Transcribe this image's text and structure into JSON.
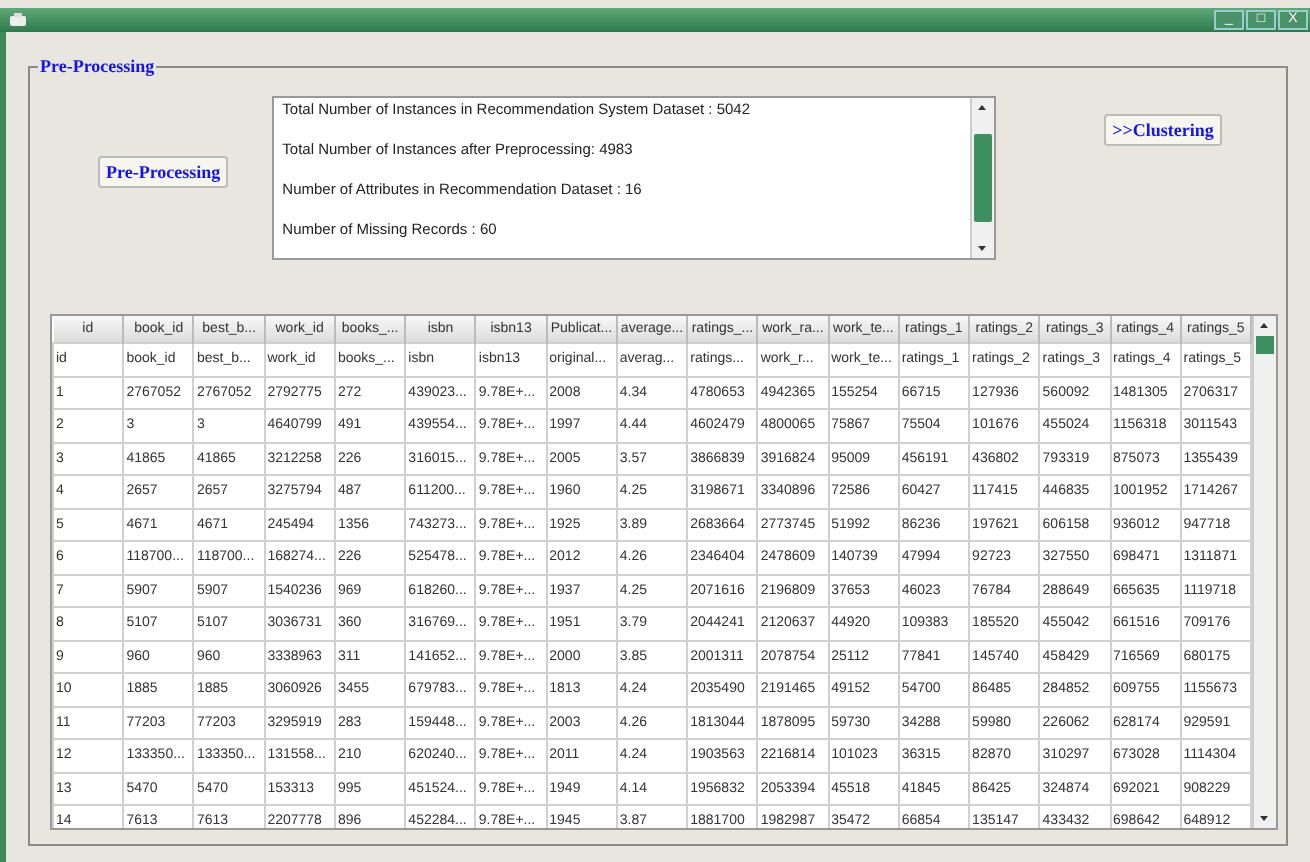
{
  "window": {
    "buttons": [
      "_",
      "□",
      "X"
    ]
  },
  "group": {
    "title": "Pre-Processing"
  },
  "preprocess_button": "Pre-Processing",
  "clustering_button": ">>Clustering",
  "log_lines": [
    "Total Number of Instances in Recommendation System Dataset  : 5042",
    "Total Number of Instances after Preprocessing: 4983",
    "Number of Attributes in Recommendation Dataset : 16",
    "Number of Missing Records : 60"
  ],
  "table": {
    "columns": [
      "id",
      "book_id",
      "best_b...",
      "work_id",
      "books_...",
      "isbn",
      "isbn13",
      "Publicat...",
      "average...",
      "ratings_...",
      "work_ra...",
      "work_te...",
      "ratings_1",
      "ratings_2",
      "ratings_3",
      "ratings_4",
      "ratings_5"
    ],
    "rows": [
      [
        "id",
        "book_id",
        "best_b...",
        "work_id",
        "books_...",
        "isbn",
        "isbn13",
        "original...",
        "averag...",
        "ratings...",
        "work_r...",
        "work_te...",
        "ratings_1",
        "ratings_2",
        "ratings_3",
        "ratings_4",
        "ratings_5"
      ],
      [
        "1",
        "2767052",
        "2767052",
        "2792775",
        "272",
        "439023...",
        "9.78E+...",
        "2008",
        "4.34",
        "4780653",
        "4942365",
        "155254",
        "66715",
        "127936",
        "560092",
        "1481305",
        "2706317"
      ],
      [
        "2",
        "3",
        "3",
        "4640799",
        "491",
        "439554...",
        "9.78E+...",
        "1997",
        "4.44",
        "4602479",
        "4800065",
        "75867",
        "75504",
        "101676",
        "455024",
        "1156318",
        "3011543"
      ],
      [
        "3",
        "41865",
        "41865",
        "3212258",
        "226",
        "316015...",
        "9.78E+...",
        "2005",
        "3.57",
        "3866839",
        "3916824",
        "95009",
        "456191",
        "436802",
        "793319",
        "875073",
        "1355439"
      ],
      [
        "4",
        "2657",
        "2657",
        "3275794",
        "487",
        "611200...",
        "9.78E+...",
        "1960",
        "4.25",
        "3198671",
        "3340896",
        "72586",
        "60427",
        "117415",
        "446835",
        "1001952",
        "1714267"
      ],
      [
        "5",
        "4671",
        "4671",
        "245494",
        "1356",
        "743273...",
        "9.78E+...",
        "1925",
        "3.89",
        "2683664",
        "2773745",
        "51992",
        "86236",
        "197621",
        "606158",
        "936012",
        "947718"
      ],
      [
        "6",
        "118700...",
        "118700...",
        "168274...",
        "226",
        "525478...",
        "9.78E+...",
        "2012",
        "4.26",
        "2346404",
        "2478609",
        "140739",
        "47994",
        "92723",
        "327550",
        "698471",
        "1311871"
      ],
      [
        "7",
        "5907",
        "5907",
        "1540236",
        "969",
        "618260...",
        "9.78E+...",
        "1937",
        "4.25",
        "2071616",
        "2196809",
        "37653",
        "46023",
        "76784",
        "288649",
        "665635",
        "1119718"
      ],
      [
        "8",
        "5107",
        "5107",
        "3036731",
        "360",
        "316769...",
        "9.78E+...",
        "1951",
        "3.79",
        "2044241",
        "2120637",
        "44920",
        "109383",
        "185520",
        "455042",
        "661516",
        "709176"
      ],
      [
        "9",
        "960",
        "960",
        "3338963",
        "311",
        "141652...",
        "9.78E+...",
        "2000",
        "3.85",
        "2001311",
        "2078754",
        "25112",
        "77841",
        "145740",
        "458429",
        "716569",
        "680175"
      ],
      [
        "10",
        "1885",
        "1885",
        "3060926",
        "3455",
        "679783...",
        "9.78E+...",
        "1813",
        "4.24",
        "2035490",
        "2191465",
        "49152",
        "54700",
        "86485",
        "284852",
        "609755",
        "1155673"
      ],
      [
        "11",
        "77203",
        "77203",
        "3295919",
        "283",
        "159448...",
        "9.78E+...",
        "2003",
        "4.26",
        "1813044",
        "1878095",
        "59730",
        "34288",
        "59980",
        "226062",
        "628174",
        "929591"
      ],
      [
        "12",
        "133350...",
        "133350...",
        "131558...",
        "210",
        "620240...",
        "9.78E+...",
        "2011",
        "4.24",
        "1903563",
        "2216814",
        "101023",
        "36315",
        "82870",
        "310297",
        "673028",
        "1114304"
      ],
      [
        "13",
        "5470",
        "5470",
        "153313",
        "995",
        "451524...",
        "9.78E+...",
        "1949",
        "4.14",
        "1956832",
        "2053394",
        "45518",
        "41845",
        "86425",
        "324874",
        "692021",
        "908229"
      ],
      [
        "14",
        "7613",
        "7613",
        "2207778",
        "896",
        "452284...",
        "9.78E+...",
        "1945",
        "3.87",
        "1881700",
        "1982987",
        "35472",
        "66854",
        "135147",
        "433432",
        "698642",
        "648912"
      ]
    ]
  }
}
